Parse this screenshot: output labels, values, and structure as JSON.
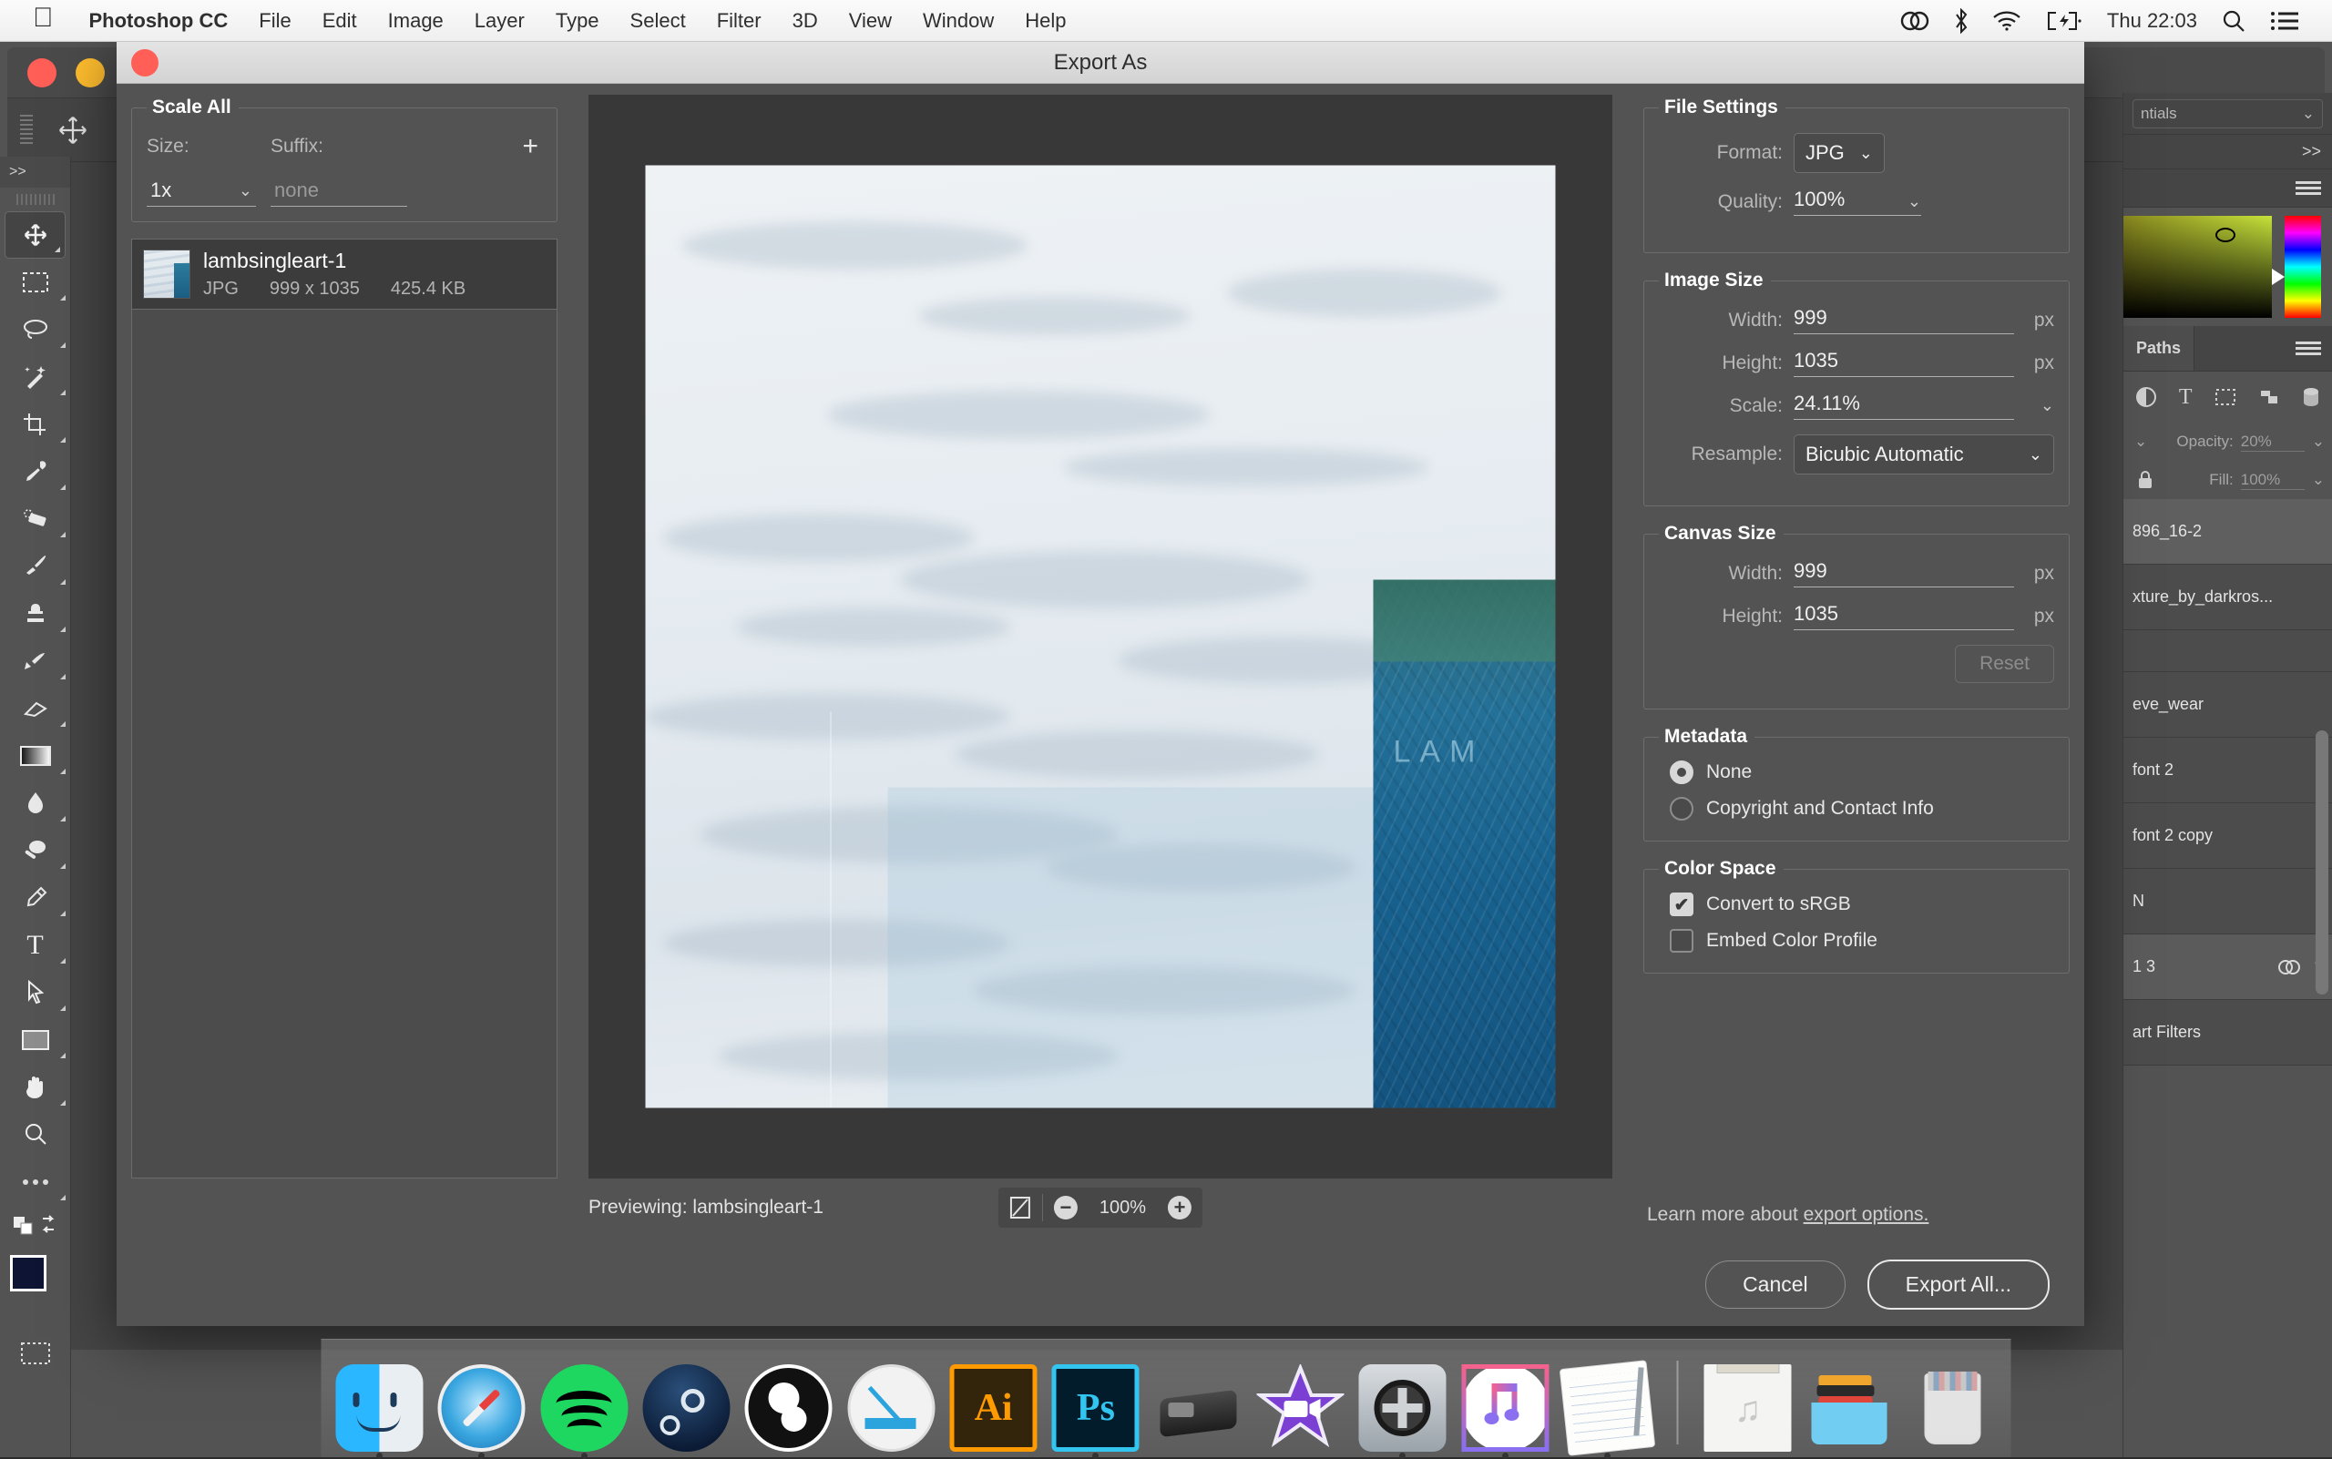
{
  "menubar": {
    "apple_icon": "apple-logo",
    "app_name": "Photoshop CC",
    "items": [
      "File",
      "Edit",
      "Image",
      "Layer",
      "Type",
      "Select",
      "Filter",
      "3D",
      "View",
      "Window",
      "Help"
    ],
    "status_icons": [
      "creative-cloud-icon",
      "bluetooth-icon",
      "wifi-icon",
      "battery-charging-icon"
    ],
    "clock": "Thu 22:03",
    "right_icons": [
      "spotlight-search-icon",
      "notification-center-icon"
    ]
  },
  "dialog": {
    "title": "Export As",
    "scale_all": {
      "legend": "Scale All",
      "size_label": "Size:",
      "suffix_label": "Suffix:",
      "add_button": "+",
      "size_value": "1x",
      "suffix_placeholder": "none"
    },
    "files": [
      {
        "name": "lambsingleart-1",
        "format": "JPG",
        "dimensions": "999 x 1035",
        "filesize": "425.4 KB"
      }
    ],
    "preview": {
      "previewing_label": "Previewing:",
      "previewing_file": "lambsingleart-1",
      "zoom_level": "100%",
      "fit_icon": "fit-to-screen-icon",
      "zoom_out_icon": "minus-circle-icon",
      "zoom_in_icon": "plus-circle-icon",
      "poster_text": "LAM"
    },
    "file_settings": {
      "legend": "File Settings",
      "format_label": "Format:",
      "format_value": "JPG",
      "quality_label": "Quality:",
      "quality_value": "100%"
    },
    "image_size": {
      "legend": "Image Size",
      "width_label": "Width:",
      "width_value": "999",
      "width_unit": "px",
      "height_label": "Height:",
      "height_value": "1035",
      "height_unit": "px",
      "scale_label": "Scale:",
      "scale_value": "24.11%",
      "resample_label": "Resample:",
      "resample_value": "Bicubic Automatic"
    },
    "canvas_size": {
      "legend": "Canvas Size",
      "width_label": "Width:",
      "width_value": "999",
      "width_unit": "px",
      "height_label": "Height:",
      "height_value": "1035",
      "height_unit": "px",
      "reset_label": "Reset"
    },
    "metadata": {
      "legend": "Metadata",
      "options": [
        {
          "label": "None",
          "selected": true
        },
        {
          "label": "Copyright and Contact Info",
          "selected": false
        }
      ]
    },
    "color_space": {
      "legend": "Color Space",
      "options": [
        {
          "label": "Convert to sRGB",
          "checked": true
        },
        {
          "label": "Embed Color Profile",
          "checked": false
        }
      ]
    },
    "learn_more": {
      "prefix": "Learn more about ",
      "link": "export options."
    },
    "footer": {
      "cancel_label": "Cancel",
      "export_label": "Export All..."
    }
  },
  "photoshop": {
    "toolbar": {
      "collapse": ">>",
      "tools": [
        "move-tool-icon",
        "rectangular-marquee-tool-icon",
        "lasso-tool-icon",
        "magic-wand-tool-icon",
        "crop-tool-icon",
        "eyedropper-tool-icon",
        "healing-brush-tool-icon",
        "brush-tool-icon",
        "clone-stamp-tool-icon",
        "history-brush-tool-icon",
        "eraser-tool-icon",
        "gradient-tool-icon",
        "blur-tool-icon",
        "dodge-tool-icon",
        "pen-tool-icon",
        "type-tool-icon",
        "path-selection-tool-icon",
        "rectangle-tool-icon",
        "hand-tool-icon",
        "zoom-tool-icon",
        "more-tools-icon"
      ],
      "foreground_color": "#0e1433",
      "background_color": "#a4c639",
      "quickmask_icon": "quick-mask-icon"
    },
    "right_dock": {
      "workspace": "ntials",
      "collapse_arrows": ">>",
      "paths_tab": "Paths",
      "opacity_label": "Opacity:",
      "opacity_value": "20%",
      "fill_label": "Fill:",
      "fill_value": "100%",
      "layer_icons": [
        "adjustment-layer-icon",
        "type-layer-icon",
        "shape-layer-icon",
        "smart-object-icon",
        "3d-layer-icon"
      ],
      "layers": [
        "896_16-2",
        "xture_by_darkros...",
        "",
        "eve_wear",
        "font 2",
        "font 2 copy",
        "N",
        "1 3",
        "art Filters"
      ]
    }
  },
  "dock": {
    "items": [
      {
        "name": "finder",
        "icon": "finder-icon",
        "running": true
      },
      {
        "name": "safari",
        "icon": "safari-icon",
        "running": true
      },
      {
        "name": "spotify",
        "icon": "spotify-icon",
        "running": true
      },
      {
        "name": "steam",
        "icon": "steam-icon",
        "running": false
      },
      {
        "name": "obs",
        "icon": "obs-icon",
        "running": false
      },
      {
        "name": "sketch",
        "icon": "sketch-icon",
        "running": false
      },
      {
        "name": "illustrator",
        "icon": "illustrator-icon",
        "running": false
      },
      {
        "name": "photoshop",
        "icon": "photoshop-icon",
        "running": true
      },
      {
        "name": "scanner",
        "icon": "scanner-icon",
        "running": false
      },
      {
        "name": "imovie",
        "icon": "imovie-icon",
        "running": false
      },
      {
        "name": "system-preferences",
        "icon": "system-preferences-icon",
        "running": true
      },
      {
        "name": "itunes",
        "icon": "itunes-icon",
        "running": true
      },
      {
        "name": "notes",
        "icon": "notes-icon",
        "running": true
      }
    ],
    "stacks": [
      {
        "name": "music-stack",
        "icon": "music-document-icon"
      },
      {
        "name": "documents-stack",
        "icon": "folder-icon"
      },
      {
        "name": "trash",
        "icon": "trash-full-icon"
      }
    ]
  }
}
